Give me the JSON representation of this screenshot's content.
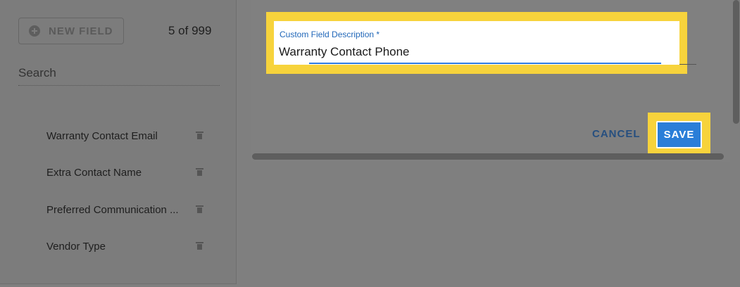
{
  "sidebar": {
    "new_field_label": "NEW FIELD",
    "count": "5 of 999",
    "search_placeholder": "Search",
    "items": [
      {
        "label": "Warranty Contact Email"
      },
      {
        "label": "Extra Contact Name"
      },
      {
        "label": "Preferred Communication ..."
      },
      {
        "label": "Vendor Type"
      }
    ]
  },
  "form": {
    "field_label": "Custom Field Description *",
    "field_value": "Warranty Contact Phone",
    "cancel_label": "CANCEL",
    "save_label": "SAVE"
  },
  "colors": {
    "highlight": "#f7d33c",
    "primary": "#2a7ed8",
    "label_blue": "#1f66b8"
  }
}
